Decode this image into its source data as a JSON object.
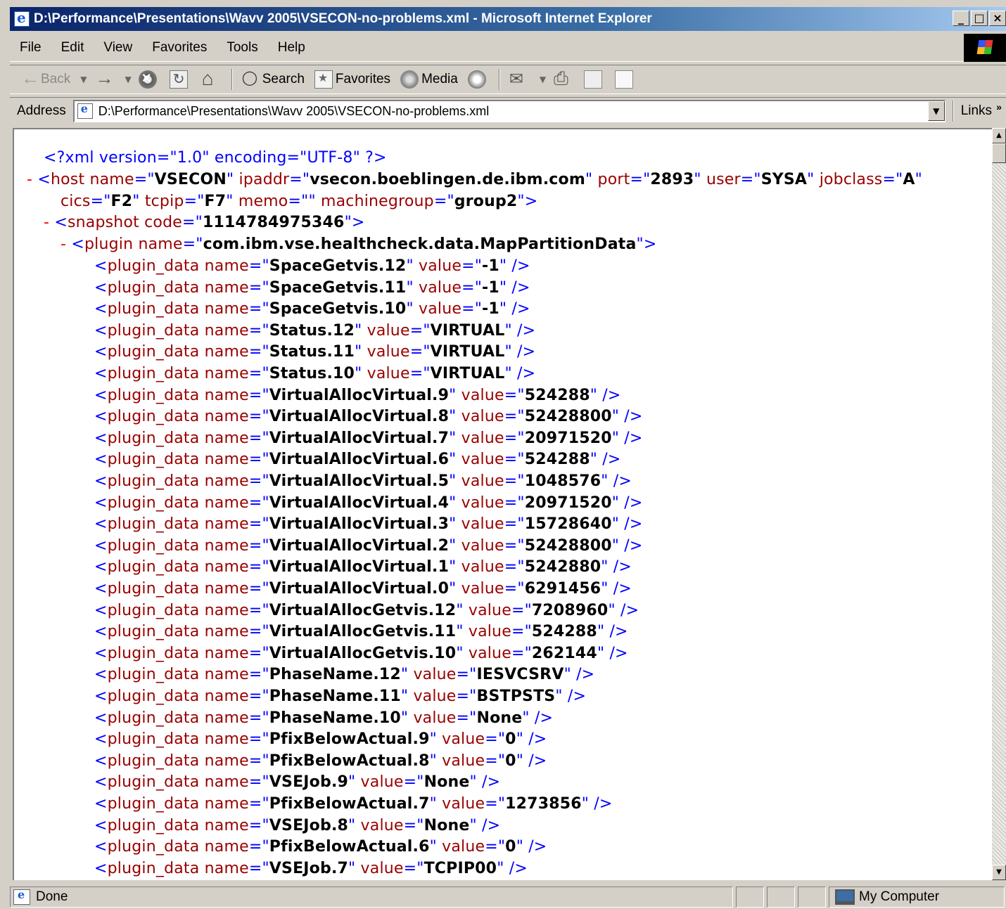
{
  "window": {
    "title": "D:\\Performance\\Presentations\\Wavv 2005\\VSECON-no-problems.xml - Microsoft Internet Explorer",
    "controls": [
      "_",
      "□",
      "×"
    ]
  },
  "menu": [
    "File",
    "Edit",
    "View",
    "Favorites",
    "Tools",
    "Help"
  ],
  "toolbar": {
    "back": "Back",
    "search": "Search",
    "favorites": "Favorites",
    "media": "Media"
  },
  "address": {
    "label": "Address",
    "value": "D:\\Performance\\Presentations\\Wavv 2005\\VSECON-no-problems.xml",
    "links": "Links"
  },
  "xml": {
    "declaration": "<?xml version=\"1.0\" encoding=\"UTF-8\" ?>",
    "host": {
      "name": "VSECON",
      "ipaddr": "vsecon.boeblingen.de.ibm.com",
      "port": "2893",
      "user": "SYSA",
      "jobclass": "A",
      "cics": "F2",
      "tcpip": "F7",
      "memo": "",
      "machinegroup": "group2"
    },
    "snapshot_code": "1114784975346",
    "plugin_name": "com.ibm.vse.healthcheck.data.MapPartitionData",
    "plugin_data": [
      {
        "name": "SpaceGetvis.12",
        "value": "-1"
      },
      {
        "name": "SpaceGetvis.11",
        "value": "-1"
      },
      {
        "name": "SpaceGetvis.10",
        "value": "-1"
      },
      {
        "name": "Status.12",
        "value": "VIRTUAL"
      },
      {
        "name": "Status.11",
        "value": "VIRTUAL"
      },
      {
        "name": "Status.10",
        "value": "VIRTUAL"
      },
      {
        "name": "VirtualAllocVirtual.9",
        "value": "524288"
      },
      {
        "name": "VirtualAllocVirtual.8",
        "value": "52428800"
      },
      {
        "name": "VirtualAllocVirtual.7",
        "value": "20971520"
      },
      {
        "name": "VirtualAllocVirtual.6",
        "value": "524288"
      },
      {
        "name": "VirtualAllocVirtual.5",
        "value": "1048576"
      },
      {
        "name": "VirtualAllocVirtual.4",
        "value": "20971520"
      },
      {
        "name": "VirtualAllocVirtual.3",
        "value": "15728640"
      },
      {
        "name": "VirtualAllocVirtual.2",
        "value": "52428800"
      },
      {
        "name": "VirtualAllocVirtual.1",
        "value": "5242880"
      },
      {
        "name": "VirtualAllocVirtual.0",
        "value": "6291456"
      },
      {
        "name": "VirtualAllocGetvis.12",
        "value": "7208960"
      },
      {
        "name": "VirtualAllocGetvis.11",
        "value": "524288"
      },
      {
        "name": "VirtualAllocGetvis.10",
        "value": "262144"
      },
      {
        "name": "PhaseName.12",
        "value": "IESVCSRV"
      },
      {
        "name": "PhaseName.11",
        "value": "BSTPSTS"
      },
      {
        "name": "PhaseName.10",
        "value": "None"
      },
      {
        "name": "PfixBelowActual.9",
        "value": "0"
      },
      {
        "name": "PfixBelowActual.8",
        "value": "0"
      },
      {
        "name": "VSEJob.9",
        "value": "None"
      },
      {
        "name": "PfixBelowActual.7",
        "value": "1273856"
      },
      {
        "name": "VSEJob.8",
        "value": "None"
      },
      {
        "name": "PfixBelowActual.6",
        "value": "0"
      },
      {
        "name": "VSEJob.7",
        "value": "TCPIP00"
      }
    ]
  },
  "status": {
    "text": "Done",
    "zone": "My Computer"
  }
}
